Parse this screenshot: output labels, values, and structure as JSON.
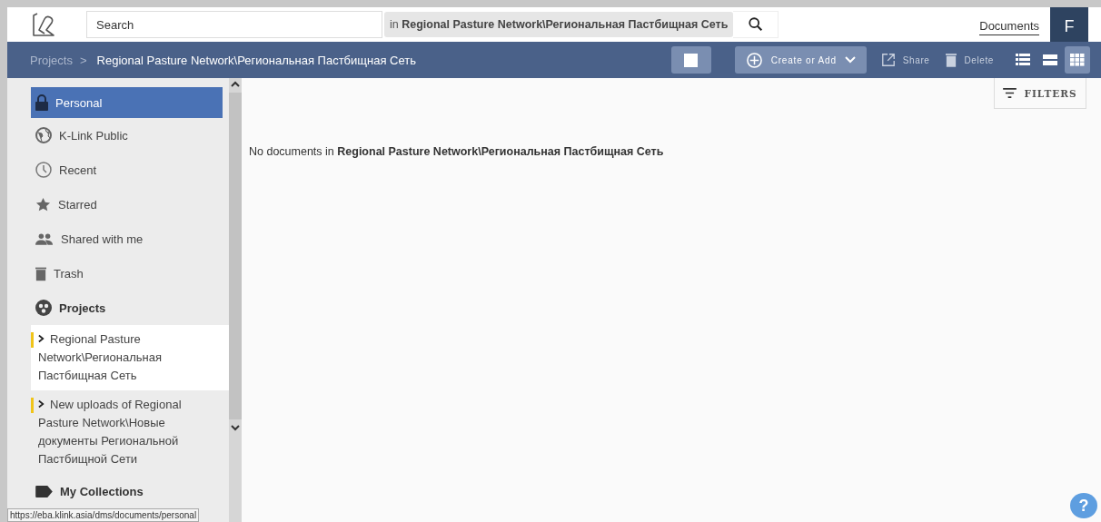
{
  "header": {
    "search": {
      "placeholder": "Search"
    },
    "scope": {
      "prefix": "in",
      "name": "Regional Pasture Network\\Региональная Пастбищная Сеть"
    },
    "documents_link": "Documents",
    "avatar": "F"
  },
  "toolbar": {
    "breadcrumb": [
      "Projects",
      "Regional Pasture Network\\Региональная Пастбищная Сеть"
    ],
    "separator": ">",
    "select_all": {
      "checked": false
    },
    "create": "Create or Add",
    "share": "Share",
    "delete": "Delete",
    "views": [
      {
        "kind": "details",
        "selected": false
      },
      {
        "kind": "list",
        "selected": false
      },
      {
        "kind": "grid",
        "selected": true
      }
    ]
  },
  "sidebar": {
    "items": [
      {
        "kind": "lock",
        "label": "Personal",
        "selected": true
      },
      {
        "kind": "globe",
        "label": "K-Link Public",
        "selected": false
      },
      {
        "kind": "clock",
        "label": "Recent",
        "selected": false
      },
      {
        "kind": "star",
        "label": "Starred",
        "selected": false
      },
      {
        "kind": "people",
        "label": "Shared with me",
        "selected": false
      },
      {
        "kind": "trash",
        "label": "Trash",
        "selected": false
      }
    ],
    "projects_heading": "Projects",
    "projects": [
      {
        "label": "Regional Pasture Network\\Региональная Пастбищная Сеть",
        "selected": true
      },
      {
        "label": "New uploads of Regional Pasture Network\\Новые документы Региональной Пастбищной Сети",
        "selected": false
      }
    ],
    "collections_heading": "My Collections"
  },
  "filters": "FILTERS",
  "empty": {
    "text": "No documents in",
    "name": "Regional Pasture Network\\Региональная Пастбищная Сеть"
  },
  "status_url": "https://eba.klink.asia/dms/documents/personal",
  "help": "?"
}
